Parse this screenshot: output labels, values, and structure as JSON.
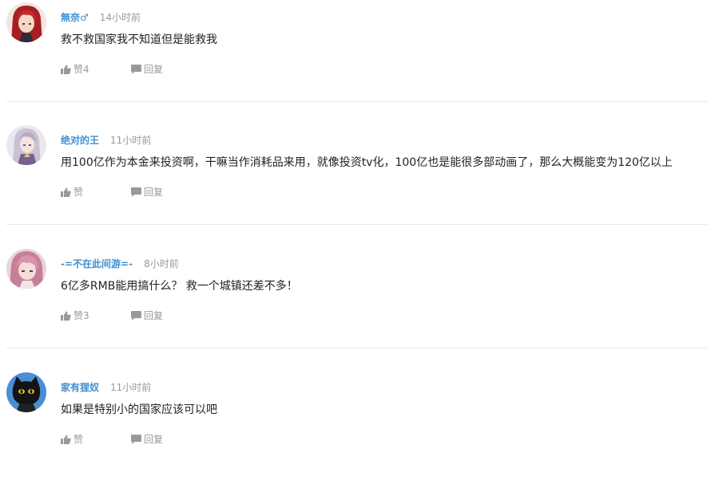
{
  "comments": [
    {
      "username": "無奈♂",
      "time": "14小时前",
      "content": "救不救国家我不知道但是能救我",
      "like_label": "赞4",
      "reply_label": "回复",
      "avatar": "red-haired-anime-character"
    },
    {
      "username": "绝对的王",
      "time": "11小时前",
      "content": "用100亿作为本金来投资啊，干嘛当作消耗品来用，就像投资tv化，100亿也是能很多部动画了，那么大概能变为120亿以上",
      "like_label": "赞",
      "reply_label": "回复",
      "avatar": "silver-haired-anime-character"
    },
    {
      "username": "-=不在此间游=-",
      "time": "8小时前",
      "content": "6亿多RMB能用搞什么？ 救一个城镇还差不多！",
      "like_label": "赞3",
      "reply_label": "回复",
      "avatar": "pink-haired-anime-character"
    },
    {
      "username": "家有狸奴",
      "time": "11小时前",
      "content": "如果是特别小的国家应该可以吧",
      "like_label": "赞",
      "reply_label": "回复",
      "avatar": "black-cat-character"
    }
  ],
  "colors": {
    "username": "#3f8fd2",
    "meta": "#999999",
    "text": "#222222",
    "divider": "#e8e8e8"
  },
  "icons": {
    "like": "thumbs-up-icon",
    "reply": "speech-bubble-icon"
  }
}
